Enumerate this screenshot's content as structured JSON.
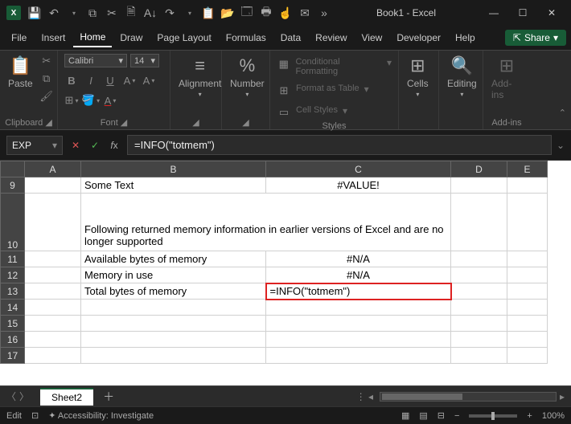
{
  "title": "Book1 - Excel",
  "qat_ellipsis": "»",
  "menu": {
    "file": "File",
    "insert": "Insert",
    "home": "Home",
    "draw": "Draw",
    "page_layout": "Page Layout",
    "formulas": "Formulas",
    "data": "Data",
    "review": "Review",
    "view": "View",
    "developer": "Developer",
    "help": "Help",
    "share": "Share"
  },
  "ribbon": {
    "clipboard": {
      "paste": "Paste",
      "label": "Clipboard"
    },
    "font": {
      "name": "Calibri",
      "size": "14",
      "label": "Font"
    },
    "alignment": {
      "label": "Alignment"
    },
    "number": {
      "label": "Number"
    },
    "styles": {
      "cond": "Conditional Formatting",
      "table": "Format as Table",
      "cell": "Cell Styles",
      "label": "Styles"
    },
    "cells": {
      "label": "Cells"
    },
    "editing": {
      "label": "Editing"
    },
    "addins": {
      "label": "Add-ins"
    }
  },
  "formula_bar": {
    "name_box": "EXP",
    "formula": "=INFO(\"totmem\")"
  },
  "columns": [
    "A",
    "B",
    "C",
    "D",
    "E"
  ],
  "rows": [
    "9",
    "10",
    "11",
    "12",
    "13",
    "14",
    "15",
    "16",
    "17"
  ],
  "cells": {
    "B9": "Some Text",
    "C9": "#VALUE!",
    "B10": "Following returned memory information in earlier versions of Excel and are no longer supported",
    "B11": "Available bytes of memory",
    "C11": "#N/A",
    "B12": "Memory in use",
    "C12": "#N/A",
    "B13": "Total bytes of memory",
    "C13": "=INFO(\"totmem\")"
  },
  "sheet": {
    "active": "Sheet2"
  },
  "status": {
    "mode": "Edit",
    "accessibility": "Accessibility: Investigate",
    "zoom": "100%"
  }
}
